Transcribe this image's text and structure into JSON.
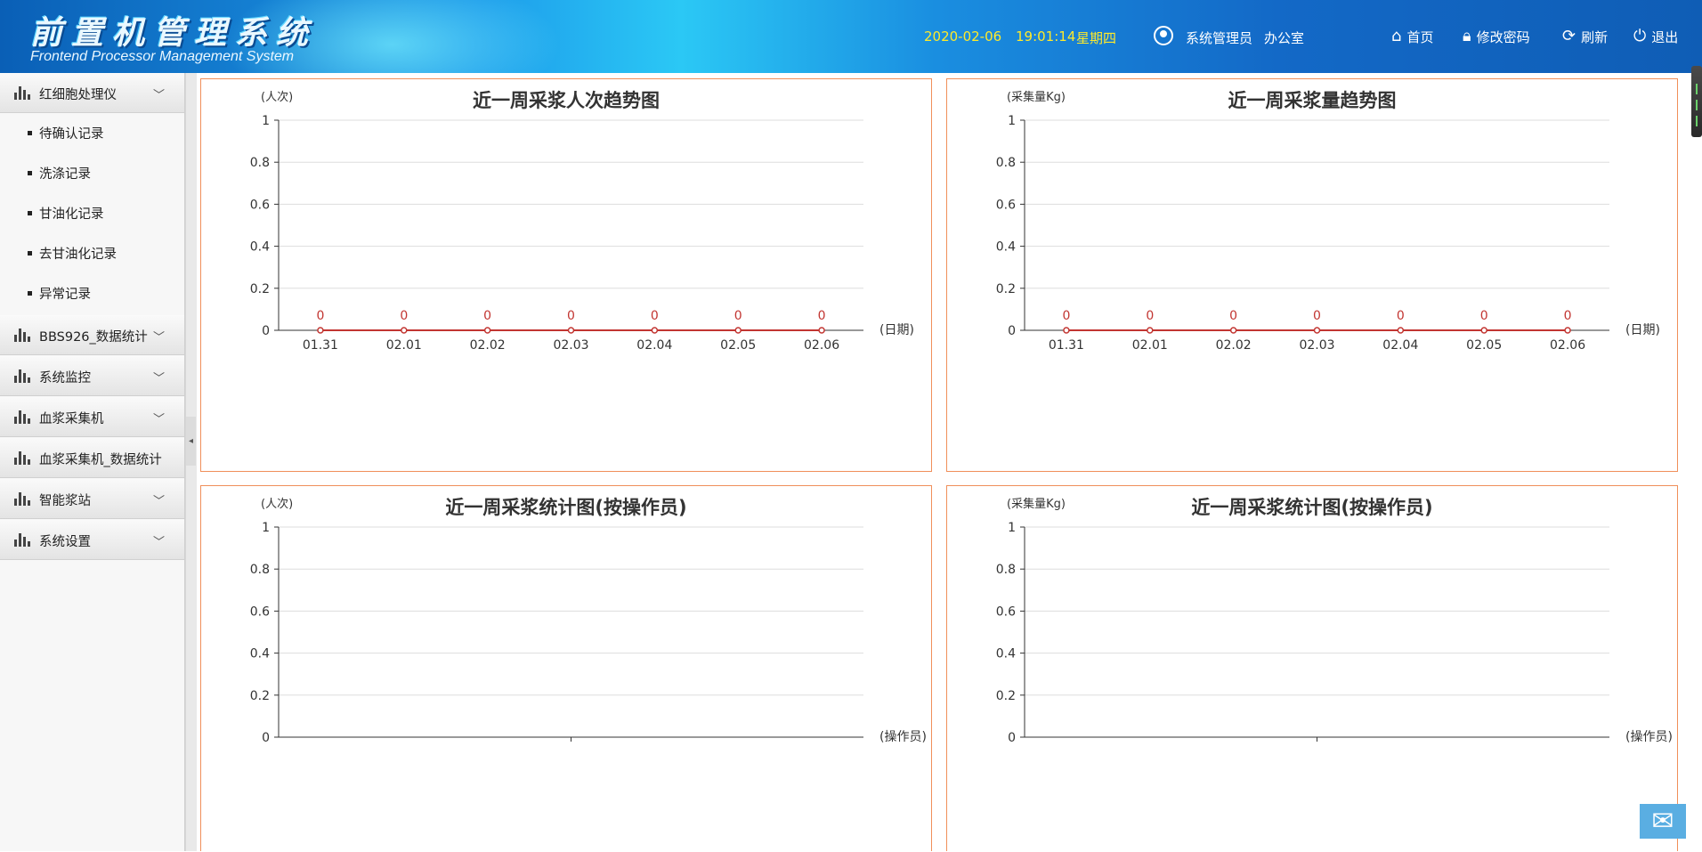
{
  "header": {
    "logo_cn": "前置机管理系统",
    "logo_en": "Frontend Processor Management System",
    "date": "2020-02-06",
    "time": "19:01:14",
    "weekday": "星期四",
    "user": "系统管理员",
    "dept": "办公室",
    "buttons": {
      "home": "首页",
      "password": "修改密码",
      "refresh": "刷新",
      "logout": "退出"
    }
  },
  "sidebar": {
    "groups": [
      {
        "label": "红细胞处理仪",
        "expanded": true
      },
      {
        "label": "BBS926_数据统计"
      },
      {
        "label": "系统监控"
      },
      {
        "label": "血浆采集机"
      },
      {
        "label": "血浆采集机_数据统计"
      },
      {
        "label": "智能浆站"
      },
      {
        "label": "系统设置"
      }
    ],
    "sub_items": [
      "待确认记录",
      "洗涤记录",
      "甘油化记录",
      "去甘油化记录",
      "异常记录"
    ]
  },
  "chart_data": [
    {
      "type": "line",
      "title": "近一周采浆人次趋势图",
      "ylabel": "(人次)",
      "xlabel": "(日期)",
      "categories": [
        "01.31",
        "02.01",
        "02.02",
        "02.03",
        "02.04",
        "02.05",
        "02.06"
      ],
      "series": [
        {
          "values": [
            0,
            0,
            0,
            0,
            0,
            0,
            0
          ]
        }
      ],
      "ylim": [
        0,
        1
      ],
      "yticks": [
        "0",
        "0.2",
        "0.4",
        "0.6",
        "0.8",
        "1"
      ],
      "color": "#c23531",
      "grid": true
    },
    {
      "type": "line",
      "title": "近一周采浆量趋势图",
      "ylabel": "(采集量Kg)",
      "xlabel": "(日期)",
      "categories": [
        "01.31",
        "02.01",
        "02.02",
        "02.03",
        "02.04",
        "02.05",
        "02.06"
      ],
      "series": [
        {
          "values": [
            0,
            0,
            0,
            0,
            0,
            0,
            0
          ]
        }
      ],
      "ylim": [
        0,
        1
      ],
      "yticks": [
        "0",
        "0.2",
        "0.4",
        "0.6",
        "0.8",
        "1"
      ],
      "color": "#c23531",
      "grid": true
    },
    {
      "type": "bar",
      "title": "近一周采浆统计图(按操作员)",
      "ylabel": "(人次)",
      "xlabel": "(操作员)",
      "categories": [],
      "series": [],
      "ylim": [
        0,
        1
      ],
      "yticks": [
        "0",
        "0.2",
        "0.4",
        "0.6",
        "0.8",
        "1"
      ],
      "grid": true
    },
    {
      "type": "bar",
      "title": "近一周采浆统计图(按操作员)",
      "ylabel": "(采集量Kg)",
      "xlabel": "(操作员)",
      "categories": [],
      "series": [],
      "ylim": [
        0,
        1
      ],
      "yticks": [
        "0",
        "0.2",
        "0.4",
        "0.6",
        "0.8",
        "1"
      ],
      "grid": true
    }
  ]
}
